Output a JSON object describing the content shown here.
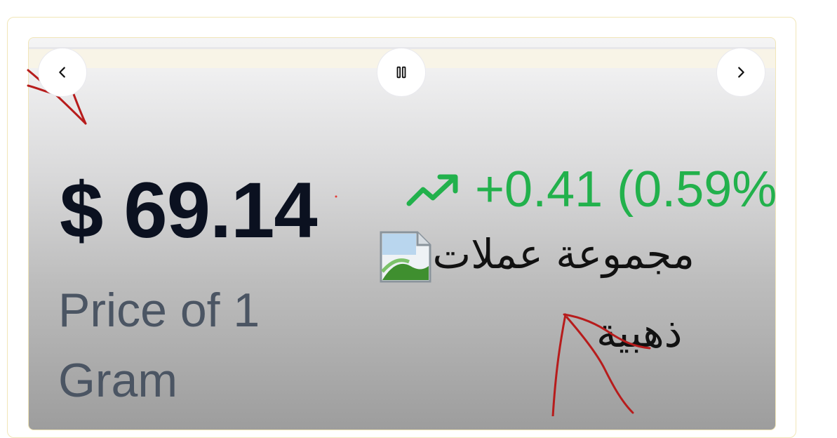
{
  "carousel": {
    "prev_icon": "chevron-left-icon",
    "pause_icon": "pause-icon",
    "next_icon": "chevron-right-icon"
  },
  "quote": {
    "price": "$ 69.14",
    "change": "+0.41 (0.59%)",
    "trend_icon": "trending-up-icon",
    "price_label": "Price of 1 Gram",
    "collection_line1": "مجموعة عملات",
    "collection_line2": "ذهبية",
    "collection_image_icon": "broken-image-icon"
  },
  "colors": {
    "price": "#0b1120",
    "change_positive": "#22b14c",
    "label": "#4b5563",
    "card_border": "#f1e6b8",
    "annotation": "#b71c1c"
  }
}
